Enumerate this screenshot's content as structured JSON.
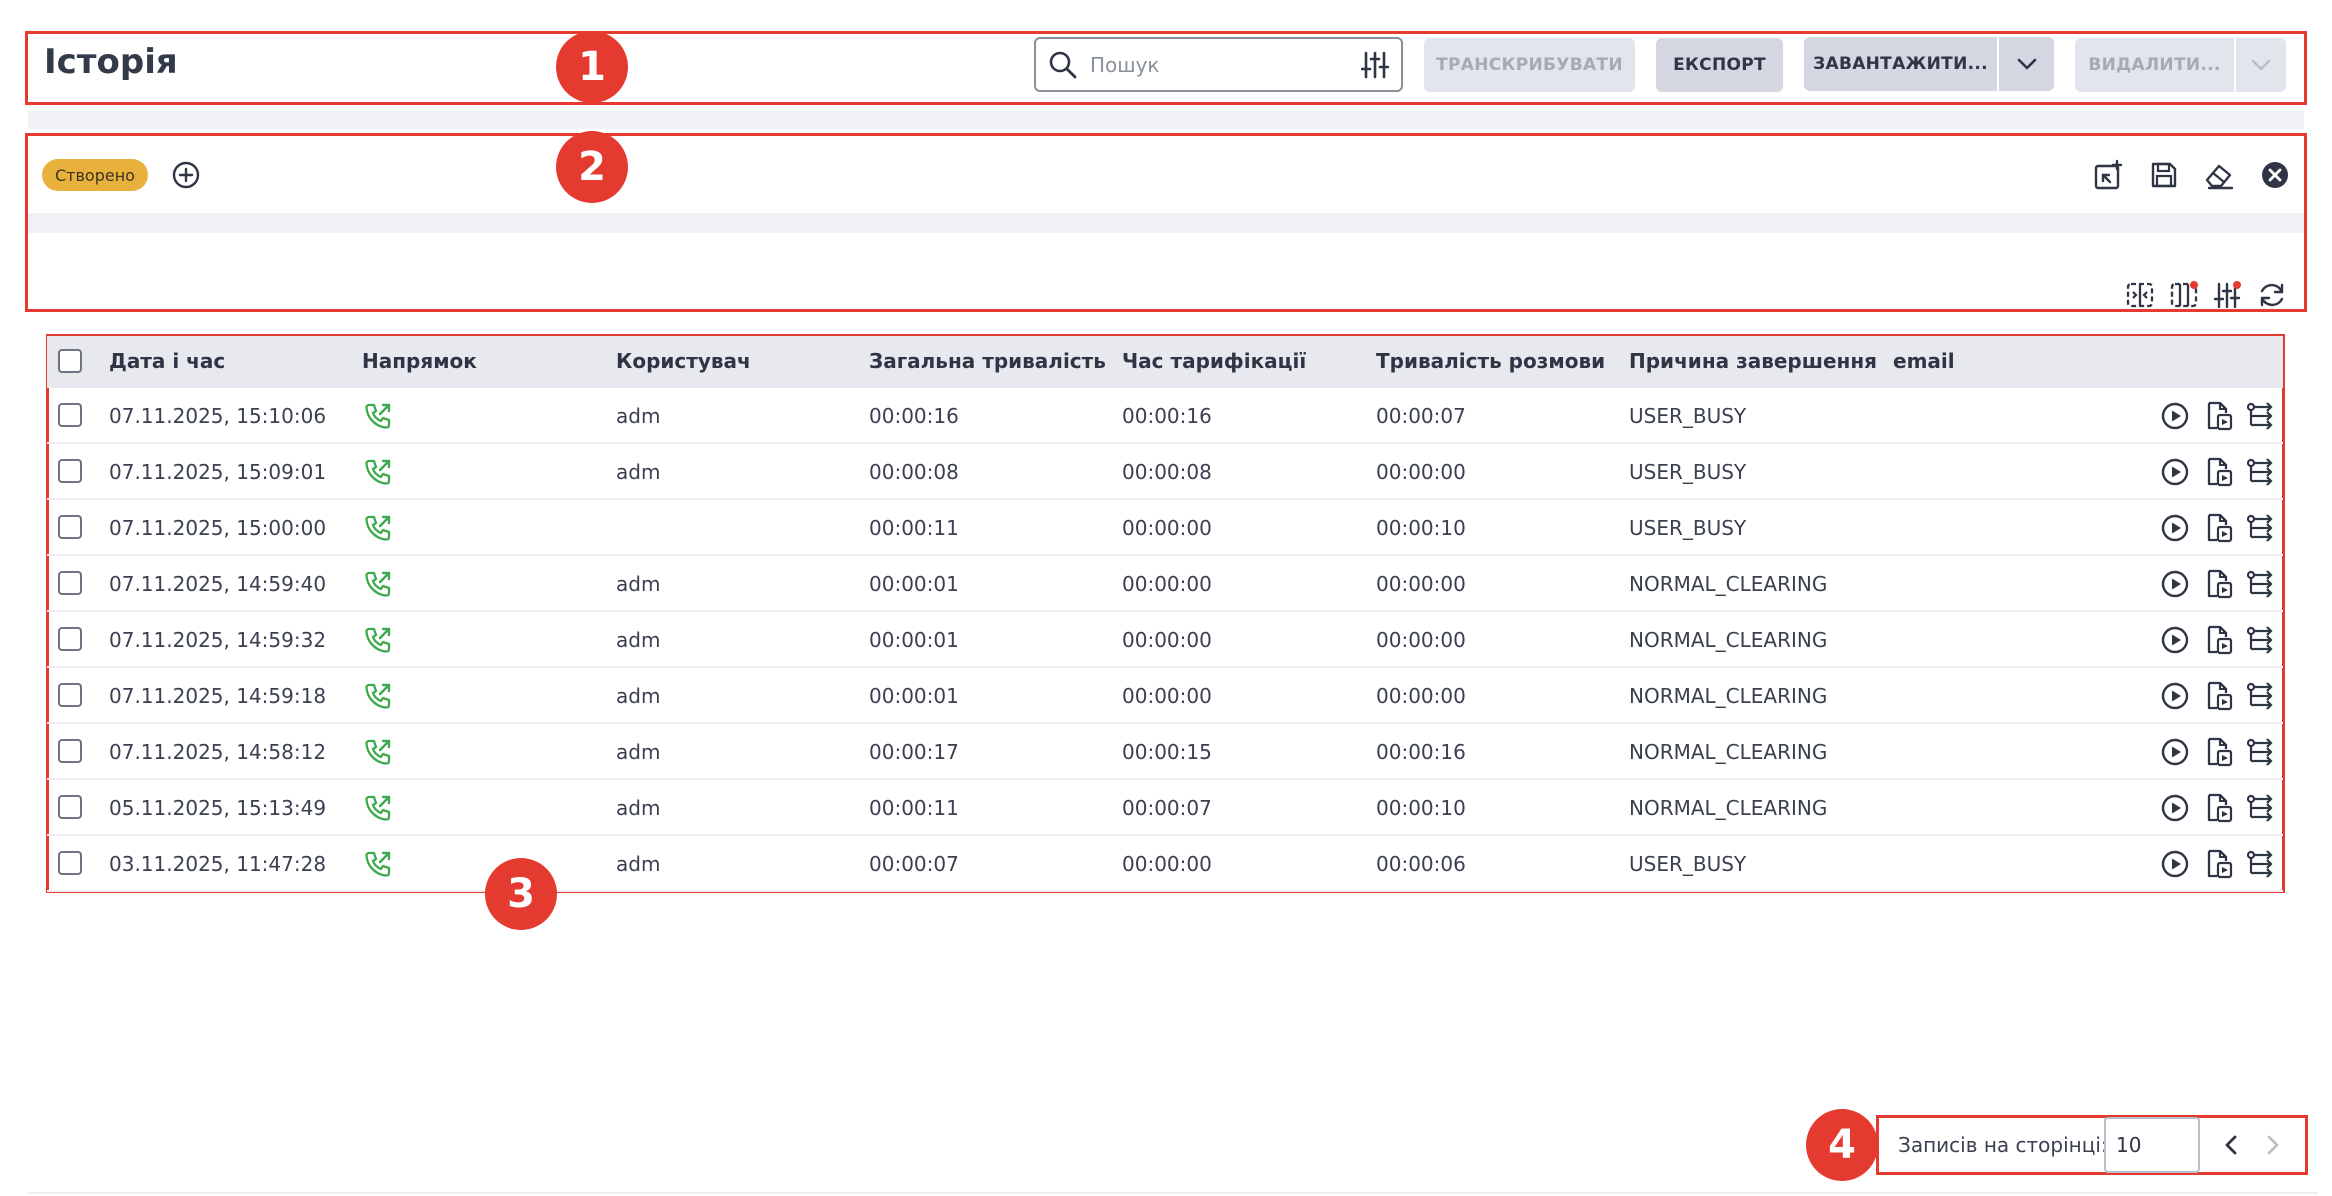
{
  "header": {
    "title": "Історія",
    "search": {
      "placeholder": "Пошук",
      "value": ""
    },
    "buttons": {
      "transcribe": "ТРАНСКРИБУВАТИ",
      "export": "ЕКСПОРТ",
      "download": "ЗАВАНТАЖИТИ...",
      "delete": "ВИДАЛИТИ..."
    }
  },
  "filters": {
    "chip": "Створено"
  },
  "table": {
    "columns": [
      "Дата і час",
      "Напрямок",
      "Користувач",
      "Загальна тривалість",
      "Час тарифікації",
      "Тривалість розмови",
      "Причина завершення",
      "email"
    ],
    "rows": [
      {
        "datetime": "07.11.2025, 15:10:06",
        "user": "adm",
        "total": "00:00:16",
        "billing": "00:00:16",
        "talk": "00:00:07",
        "reason": "USER_BUSY"
      },
      {
        "datetime": "07.11.2025, 15:09:01",
        "user": "adm",
        "total": "00:00:08",
        "billing": "00:00:08",
        "talk": "00:00:00",
        "reason": "USER_BUSY"
      },
      {
        "datetime": "07.11.2025, 15:00:00",
        "user": "",
        "total": "00:00:11",
        "billing": "00:00:00",
        "talk": "00:00:10",
        "reason": "USER_BUSY"
      },
      {
        "datetime": "07.11.2025, 14:59:40",
        "user": "adm",
        "total": "00:00:01",
        "billing": "00:00:00",
        "talk": "00:00:00",
        "reason": "NORMAL_CLEARING"
      },
      {
        "datetime": "07.11.2025, 14:59:32",
        "user": "adm",
        "total": "00:00:01",
        "billing": "00:00:00",
        "talk": "00:00:00",
        "reason": "NORMAL_CLEARING"
      },
      {
        "datetime": "07.11.2025, 14:59:18",
        "user": "adm",
        "total": "00:00:01",
        "billing": "00:00:00",
        "talk": "00:00:00",
        "reason": "NORMAL_CLEARING"
      },
      {
        "datetime": "07.11.2025, 14:58:12",
        "user": "adm",
        "total": "00:00:17",
        "billing": "00:00:15",
        "talk": "00:00:16",
        "reason": "NORMAL_CLEARING"
      },
      {
        "datetime": "05.11.2025, 15:13:49",
        "user": "adm",
        "total": "00:00:11",
        "billing": "00:00:07",
        "talk": "00:00:10",
        "reason": "NORMAL_CLEARING"
      },
      {
        "datetime": "03.11.2025, 11:47:28",
        "user": "adm",
        "total": "00:00:07",
        "billing": "00:00:00",
        "talk": "00:00:06",
        "reason": "USER_BUSY"
      }
    ]
  },
  "pagination": {
    "label": "Записів на сторінці:",
    "page_size": "10"
  },
  "annotations": [
    "1",
    "2",
    "3",
    "4"
  ],
  "colors": {
    "annotation": "#e53a2f",
    "chip": "#e8b13c",
    "direction_icon": "#3daa4f"
  }
}
